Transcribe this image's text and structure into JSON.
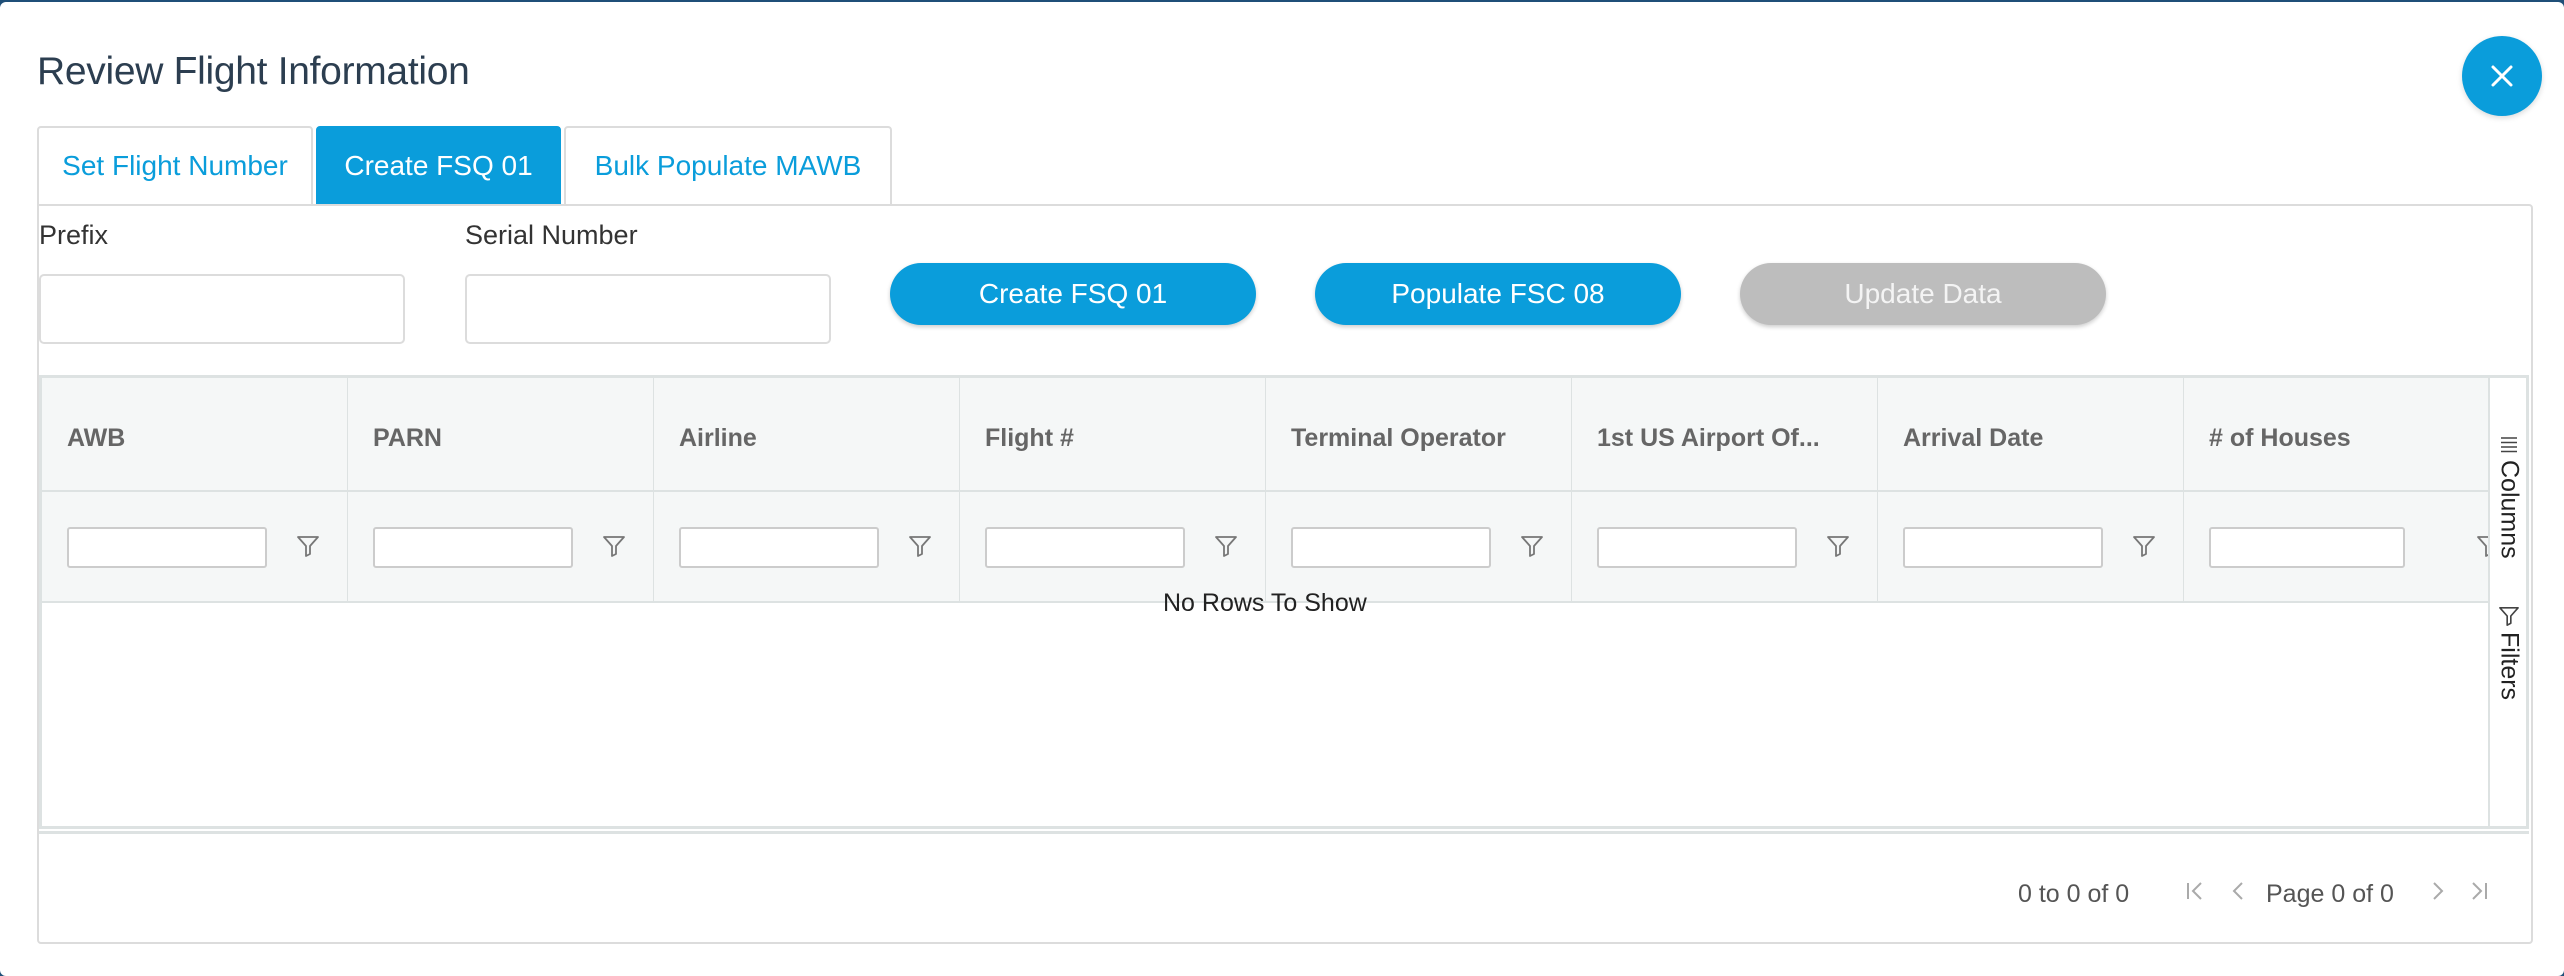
{
  "dialog": {
    "title": "Review Flight Information",
    "close_icon": "close-icon",
    "accent_color": "#0a9ddb"
  },
  "tabs": [
    {
      "label": "Set Flight Number",
      "active": false
    },
    {
      "label": "Create FSQ 01",
      "active": true
    },
    {
      "label": "Bulk Populate MAWB",
      "active": false
    }
  ],
  "form": {
    "prefix_label": "Prefix",
    "prefix_value": "",
    "serial_label": "Serial Number",
    "serial_value": ""
  },
  "actions": {
    "create_fsq": "Create FSQ 01",
    "populate_fsc": "Populate FSC 08",
    "update_data": "Update Data"
  },
  "grid": {
    "columns": [
      "AWB",
      "PARN",
      "Airline",
      "Flight #",
      "Terminal Operator",
      "1st US Airport Of...",
      "Arrival Date",
      "# of Houses"
    ],
    "empty_message": "No Rows To Show",
    "side_panel": {
      "columns": "Columns",
      "filters": "Filters"
    }
  },
  "pagination": {
    "summary": "0 to 0 of 0",
    "page_label": "Page",
    "page_current": "0",
    "of_label": "of",
    "page_total": "0"
  }
}
